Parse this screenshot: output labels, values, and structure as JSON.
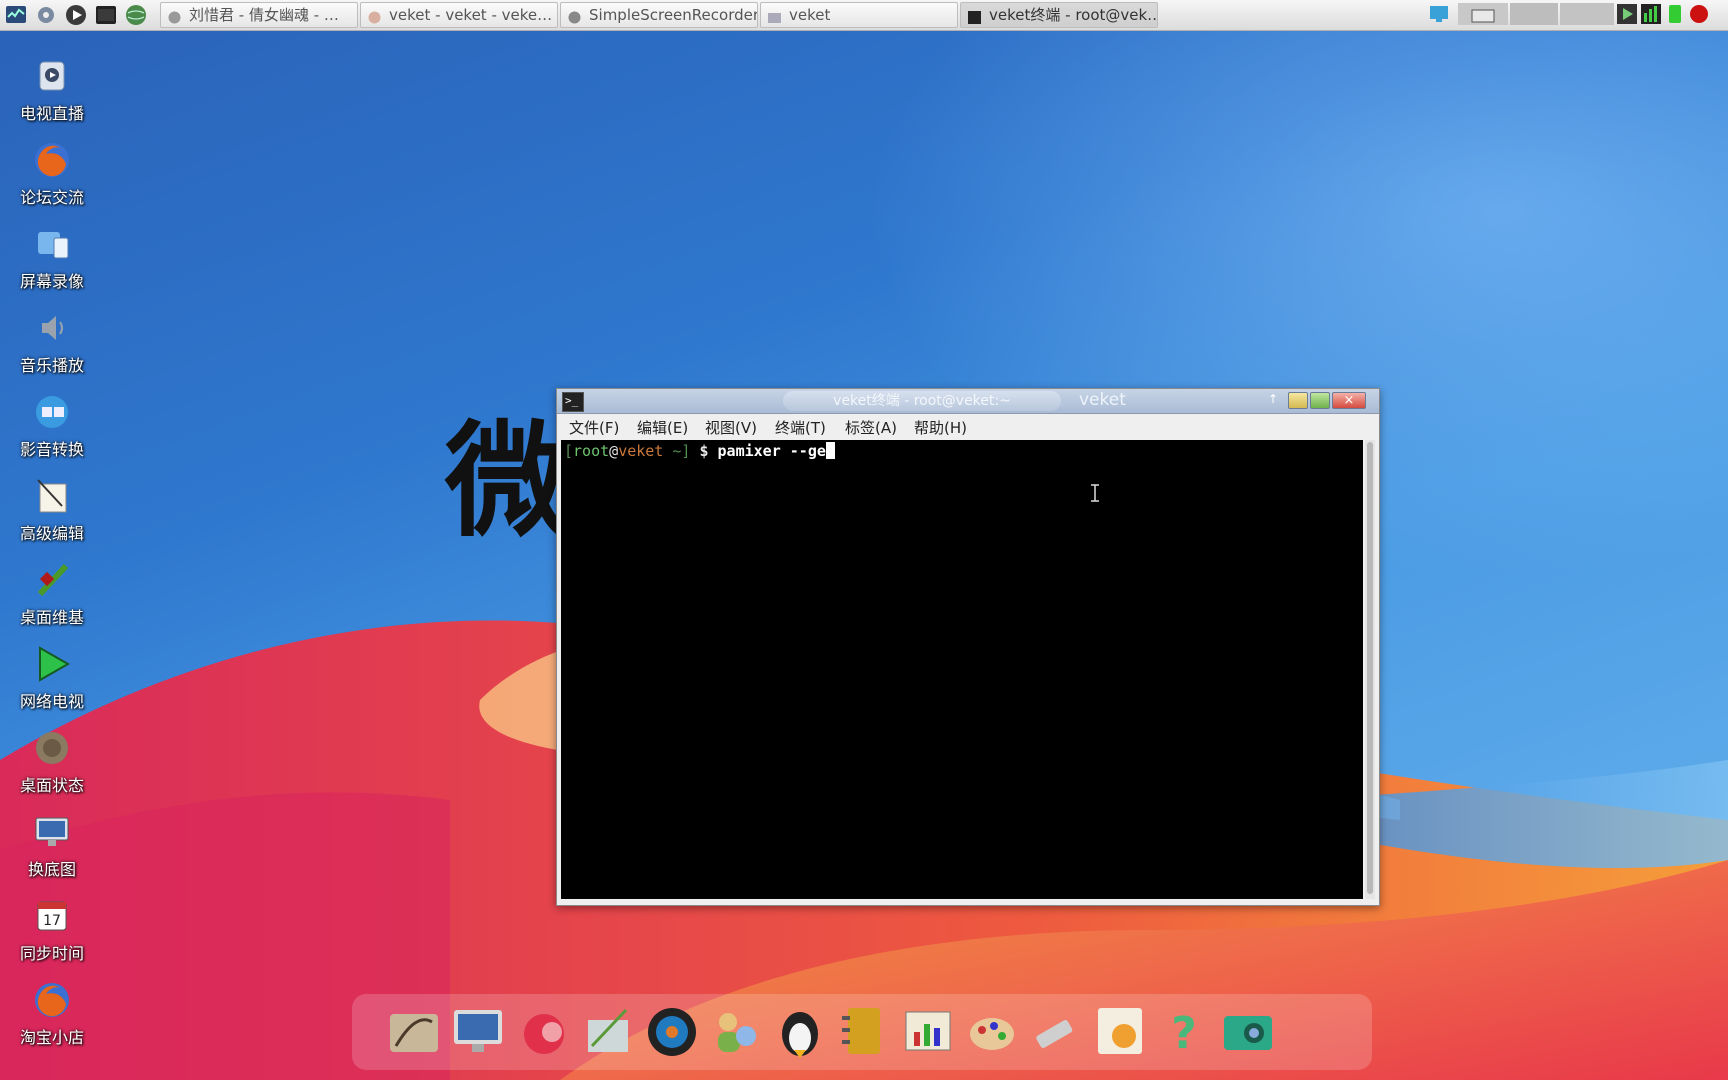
{
  "taskbar": {
    "tasks": [
      {
        "label": "刘惜君 - 倩女幽魂 - …"
      },
      {
        "label": "veket - veket - veke…"
      },
      {
        "label": "SimpleScreenRecorder"
      },
      {
        "label": "veket"
      },
      {
        "label": "veket终端 - root@vek…"
      }
    ]
  },
  "desktop": {
    "icons": [
      {
        "label": "电视直播"
      },
      {
        "label": "论坛交流"
      },
      {
        "label": "屏幕录像"
      },
      {
        "label": "音乐播放"
      },
      {
        "label": "影音转换"
      },
      {
        "label": "高级编辑"
      },
      {
        "label": "桌面维基"
      },
      {
        "label": "网络电视"
      },
      {
        "label": "桌面状态"
      },
      {
        "label": "换底图"
      },
      {
        "label": "同步时间"
      },
      {
        "label": "淘宝小店"
      }
    ],
    "background_text": "微"
  },
  "terminal": {
    "title": "veket终端 - root@veket:~",
    "title_right": "veket",
    "menu": [
      "文件(F)",
      "编辑(E)",
      "视图(V)",
      "终端(T)",
      "标签(A)",
      "帮助(H)"
    ],
    "prompt": {
      "open_bracket": "[",
      "user": "root",
      "at": "@",
      "host": "veket",
      "dir": " ~]",
      "dollar": " $ ",
      "command": "pamixer --ge"
    },
    "close_symbol": "×"
  },
  "colors": {
    "accent_title": "#a9bbd5",
    "desktop_blue": "#2f78cf"
  }
}
